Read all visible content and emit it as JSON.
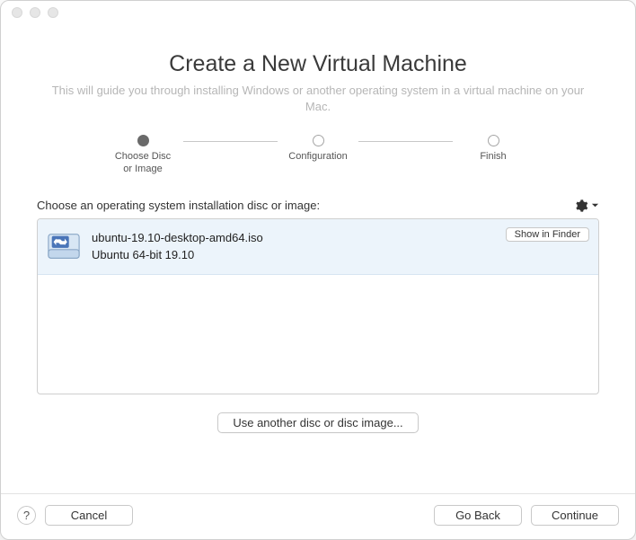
{
  "heading": "Create a New Virtual Machine",
  "subheading": "This will guide you through installing Windows or another operating system in a virtual machine on your Mac.",
  "steps": {
    "s1": "Choose Disc\nor Image",
    "s2": "Configuration",
    "s3": "Finish"
  },
  "section": {
    "prompt": "Choose an operating system installation disc or image:"
  },
  "item": {
    "filename": "ubuntu-19.10-desktop-amd64.iso",
    "description": "Ubuntu 64-bit 19.10",
    "show_in_finder": "Show in Finder"
  },
  "buttons": {
    "use_another": "Use another disc or disc image...",
    "help": "?",
    "cancel": "Cancel",
    "go_back": "Go Back",
    "continue": "Continue"
  }
}
